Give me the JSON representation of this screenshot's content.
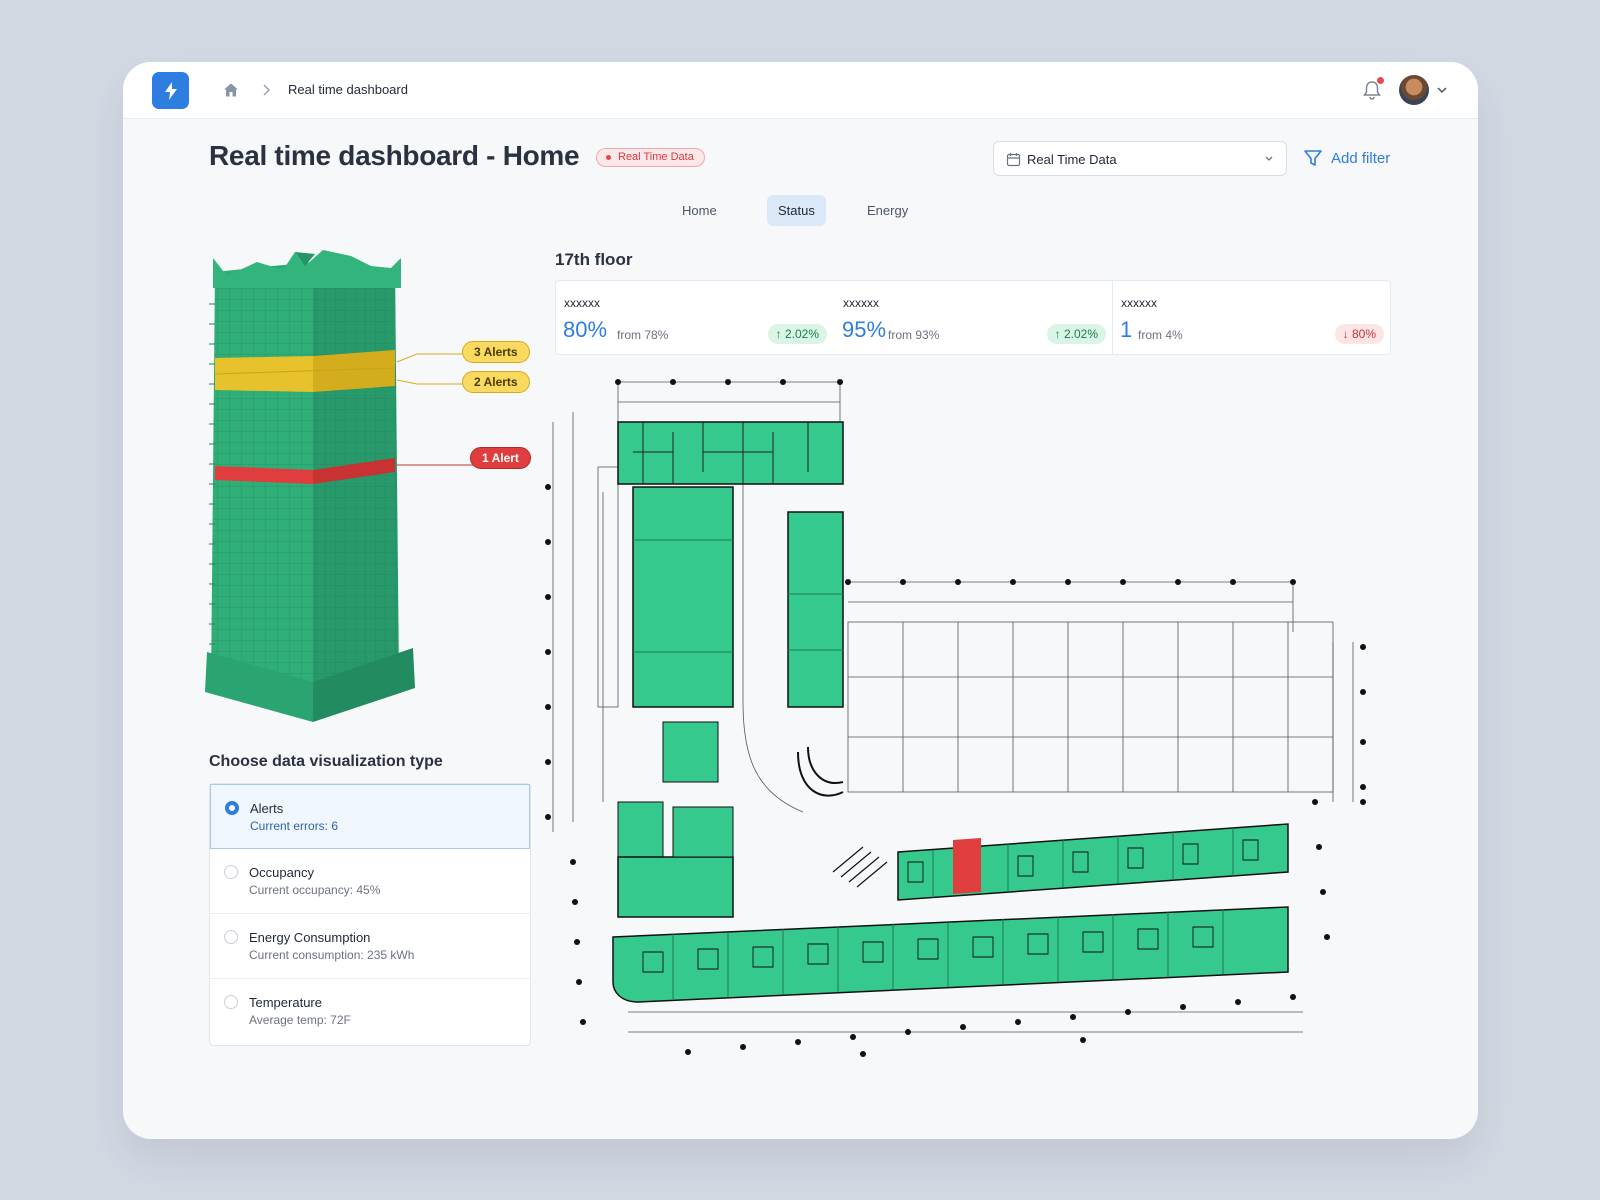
{
  "breadcrumb": {
    "current": "Real time dashboard"
  },
  "header": {
    "title": "Real time dashboard - Home",
    "badge": "Real Time Data",
    "date_select_value": "Real Time Data",
    "add_filter_label": "Add filter"
  },
  "tabs": [
    {
      "label": "Home",
      "active": false
    },
    {
      "label": "Status",
      "active": true
    },
    {
      "label": "Energy",
      "active": false
    }
  ],
  "building": {
    "alerts": [
      {
        "label": "3 Alerts",
        "level": "warning"
      },
      {
        "label": "2 Alerts",
        "level": "warning"
      },
      {
        "label": "1 Alert",
        "level": "critical"
      }
    ]
  },
  "viz": {
    "title": "Choose data visualization type",
    "options": [
      {
        "label": "Alerts",
        "sub": "Current errors: 6",
        "selected": true
      },
      {
        "label": "Occupancy",
        "sub": "Current occupancy: 45%",
        "selected": false
      },
      {
        "label": "Energy Consumption",
        "sub": "Current consumption: 235 kWh",
        "selected": false
      },
      {
        "label": "Temperature",
        "sub": "Average temp: 72F",
        "selected": false
      }
    ]
  },
  "floor": {
    "title": "17th floor",
    "stats": [
      {
        "name": "xxxxxx",
        "value": "80%",
        "from": "from 78%",
        "change": "2.02%",
        "direction": "up"
      },
      {
        "name": "xxxxxx",
        "value": "95%",
        "from": "from 93%",
        "change": "2.02%",
        "direction": "up"
      },
      {
        "name": "xxxxxx",
        "value": "1",
        "from": "from 4%",
        "change": "80%",
        "direction": "down"
      }
    ]
  },
  "colors": {
    "accent": "#2e7de0",
    "normal_zone": "#36c98e",
    "warning_zone": "#e8c22c",
    "alert_zone": "#e03e3e"
  }
}
